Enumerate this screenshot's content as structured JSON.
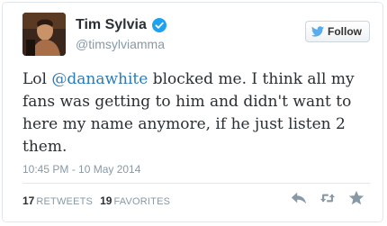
{
  "author": {
    "display_name": "Tim Sylvia",
    "handle": "@timsylviamma",
    "verified": true
  },
  "follow_button": {
    "label": "Follow"
  },
  "tweet": {
    "text_before": "Lol ",
    "mention": "@danawhite",
    "text_after": " blocked me. I think all my fans was getting to him and didn't want to here my name anymore, if he just listen 2 them."
  },
  "timestamp": "10:45 PM - 10 May 2014",
  "stats": {
    "retweets_count": "17",
    "retweets_label": "RETWEETS",
    "favorites_count": "19",
    "favorites_label": "FAVORITES"
  },
  "icons": {
    "verified": "verified-badge-icon",
    "follow": "twitter-bird-icon",
    "reply": "reply-icon",
    "retweet": "retweet-icon",
    "favorite": "star-icon"
  },
  "colors": {
    "link": "#2b7bb9",
    "verified": "#1da1f2",
    "muted": "#8899a6",
    "text": "#292f33",
    "action_icon": "#8899a6"
  }
}
